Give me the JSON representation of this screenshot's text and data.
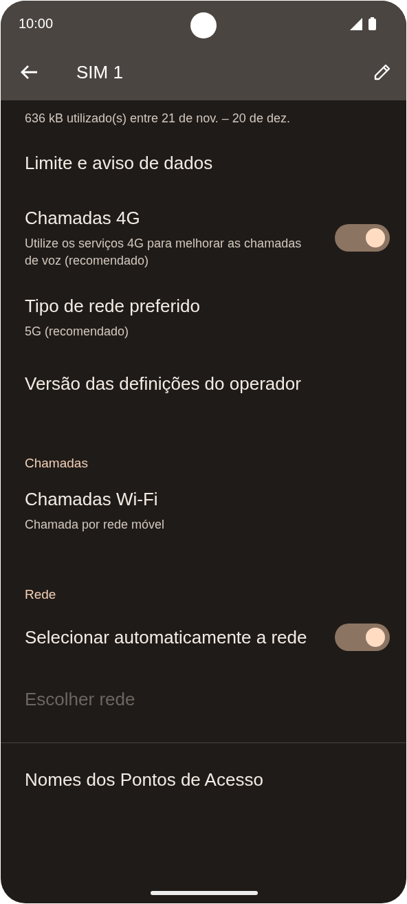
{
  "status_bar": {
    "time": "10:00"
  },
  "app_bar": {
    "title": "SIM 1"
  },
  "items": [
    {
      "kind": "summary",
      "subtitle": "636 kB utilizado(s) entre 21 de nov. – 20 de dez."
    },
    {
      "kind": "setting",
      "title": "Limite e aviso de dados",
      "disabled": false
    },
    {
      "kind": "switch",
      "title": "Chamadas 4G",
      "subtitle": "Utilize os serviços 4G para melhorar as chamadas de voz (recomendado)",
      "on": true
    },
    {
      "kind": "setting",
      "title": "Tipo de rede preferido",
      "subtitle": "5G (recomendado)",
      "disabled": false
    },
    {
      "kind": "setting",
      "title": "Versão das definições do operador",
      "disabled": false
    },
    {
      "kind": "header",
      "title": "Chamadas"
    },
    {
      "kind": "setting",
      "title": "Chamadas Wi-Fi",
      "subtitle": "Chamada por rede móvel",
      "disabled": false
    },
    {
      "kind": "header",
      "title": "Rede"
    },
    {
      "kind": "switch",
      "title": "Selecionar automaticamente a rede",
      "on": true
    },
    {
      "kind": "setting",
      "title": "Escolher rede",
      "disabled": true
    },
    {
      "kind": "divider"
    },
    {
      "kind": "setting",
      "title": "Nomes dos Pontos de Acesso",
      "disabled": false
    }
  ]
}
